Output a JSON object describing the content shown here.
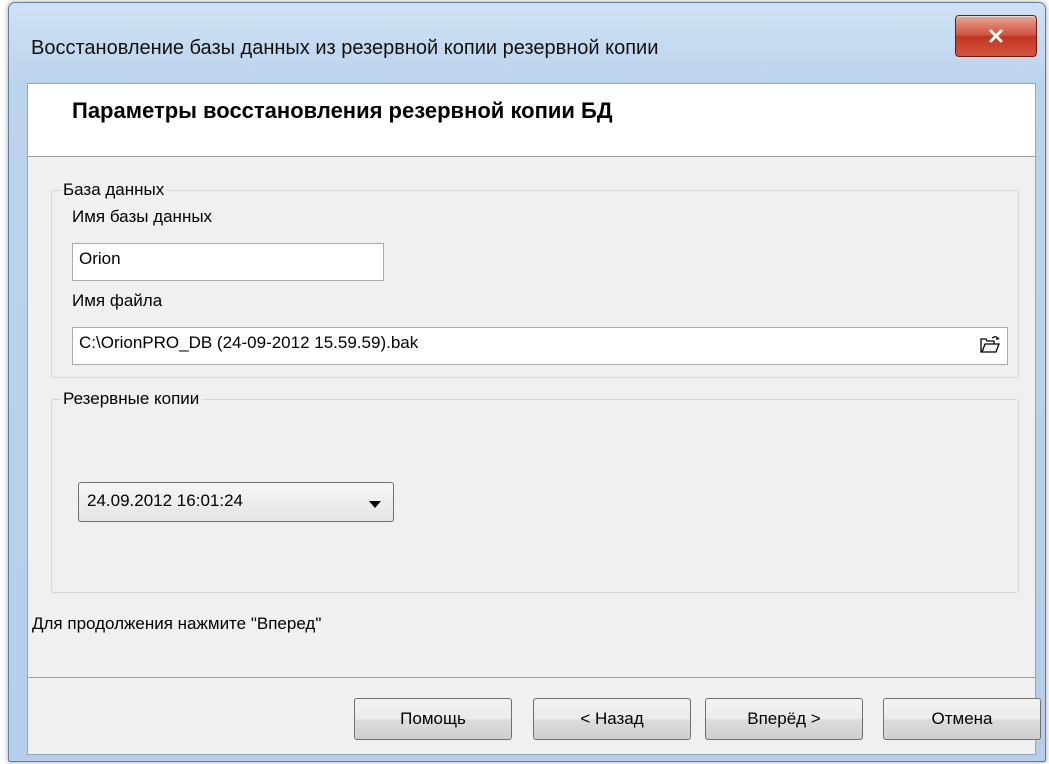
{
  "window": {
    "title": "Восстановление базы данных из резервной копии резервной копии"
  },
  "header": {
    "title": "Параметры восстановления резервной копии БД"
  },
  "database_group": {
    "legend": "База данных",
    "db_name_label": "Имя базы данных",
    "db_name_value": "Orion",
    "file_name_label": "Имя файла",
    "file_name_value": "C:\\OrionPRO_DB (24-09-2012 15.59.59).bak"
  },
  "backups_group": {
    "legend": "Резервные копии",
    "selected_backup": "24.09.2012 16:01:24"
  },
  "hint": "Для продолжения нажмите \"Вперед\"",
  "buttons": {
    "help": "Помощь",
    "back": "< Назад",
    "next": "Вперёд >",
    "cancel": "Отмена"
  },
  "colors": {
    "close_button": "#c23420",
    "dialog_background": "#f0f0f0",
    "title_frame": "#bcd3ec"
  },
  "icons": {
    "close": "close-icon",
    "browse": "open-folder-icon",
    "dropdown": "chevron-down-icon"
  }
}
